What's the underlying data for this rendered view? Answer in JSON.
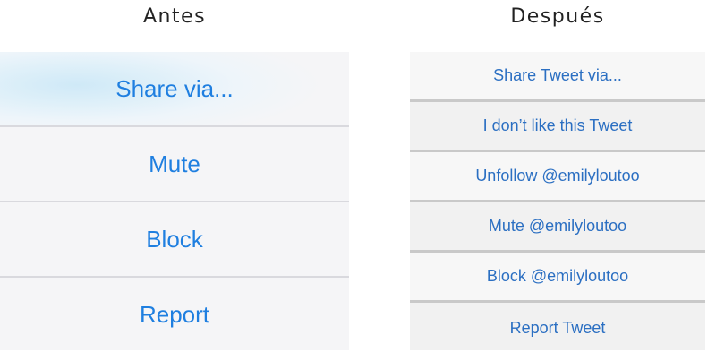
{
  "headings": {
    "before": "Antes",
    "after": "Después"
  },
  "before_menu": {
    "items": [
      "Share via...",
      "Mute",
      "Block",
      "Report"
    ]
  },
  "after_menu": {
    "items": [
      "Share Tweet via...",
      "I don’t like this Tweet",
      "Unfollow @emilyloutoo",
      "Mute @emilyloutoo",
      "Block @emilyloutoo",
      "Report Tweet"
    ]
  },
  "colors": {
    "action_text_before": "#1f7fe0",
    "action_text_after": "#2b6fc2",
    "heading_text": "#222222"
  }
}
